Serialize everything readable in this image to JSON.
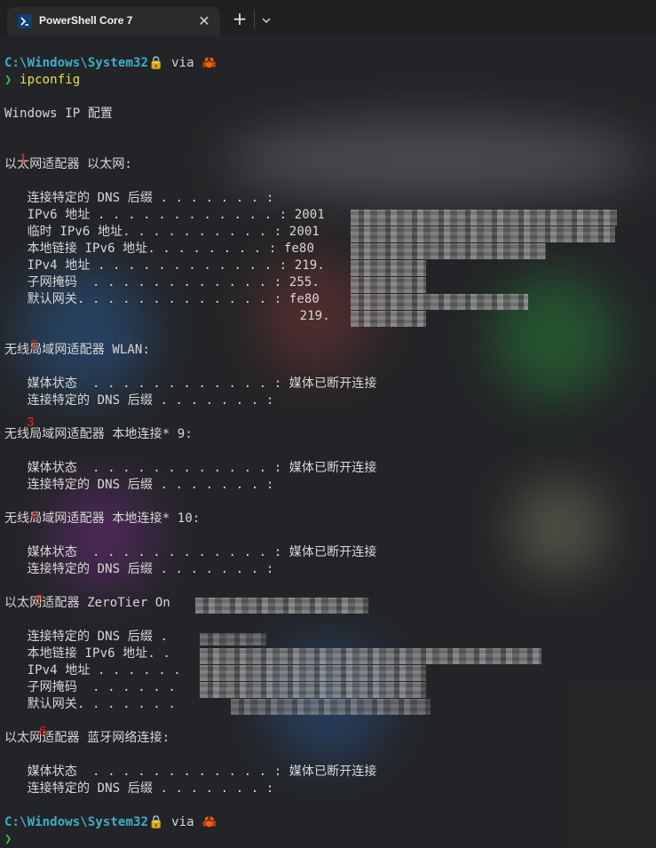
{
  "tab": {
    "title": "PowerShell Core 7",
    "icon": "powershell-icon"
  },
  "prompt": {
    "path": "C:\\Windows\\System32",
    "via": " via ",
    "symbol": "❯",
    "lock": "🔒",
    "crab": "🦀"
  },
  "command": "ipconfig",
  "output": {
    "header": "Windows IP 配置",
    "adapter1": {
      "title": "以太网适配器 以太网:",
      "dns_suffix": "   连接特定的 DNS 后缀 . . . . . . . :",
      "ipv6": "   IPv6 地址 . . . . . . . . . . . . : 2001",
      "temp_ipv6": "   临时 IPv6 地址. . . . . . . . . . : 2001",
      "link_local": "   本地链接 IPv6 地址. . . . . . . . : fe80",
      "ipv4": "   IPv4 地址 . . . . . . . . . . . . : 219.",
      "subnet": "   子网掩码  . . . . . . . . . . . . : 255.",
      "gateway": "   默认网关. . . . . . . . . . . . . : fe80",
      "gateway2": "                                       219."
    },
    "adapter2": {
      "title": "无线局域网适配器 WLAN:",
      "media": "   媒体状态  . . . . . . . . . . . . : 媒体已断开连接",
      "dns_suffix": "   连接特定的 DNS 后缀 . . . . . . . :"
    },
    "adapter3": {
      "title": "无线局域网适配器 本地连接* 9:",
      "media": "   媒体状态  . . . . . . . . . . . . : 媒体已断开连接",
      "dns_suffix": "   连接特定的 DNS 后缀 . . . . . . . :"
    },
    "adapter4": {
      "title": "无线局域网适配器 本地连接* 10:",
      "media": "   媒体状态  . . . . . . . . . . . . : 媒体已断开连接",
      "dns_suffix": "   连接特定的 DNS 后缀 . . . . . . . :"
    },
    "adapter5": {
      "title": "以太网适配器 ZeroTier On",
      "dns_suffix": "   连接特定的 DNS 后缀 .",
      "link_local": "   本地链接 IPv6 地址. .",
      "ipv4": "   IPv4 地址 . . . . . .",
      "subnet": "   子网掩码  . . . . . .",
      "gateway": "   默认网关. . . . . . ."
    },
    "adapter6": {
      "title": "以太网适配器 蓝牙网络连接:",
      "media": "   媒体状态  . . . . . . . . . . . . : 媒体已断开连接",
      "dns_suffix": "   连接特定的 DNS 后缀 . . . . . . . :"
    }
  },
  "markers": [
    "1",
    "2",
    "3",
    "4",
    "5",
    "6"
  ],
  "colors": {
    "path": "#3bb0c9",
    "prompt": "#32c04a",
    "command": "#e5e04a",
    "marker": "#e02424"
  }
}
